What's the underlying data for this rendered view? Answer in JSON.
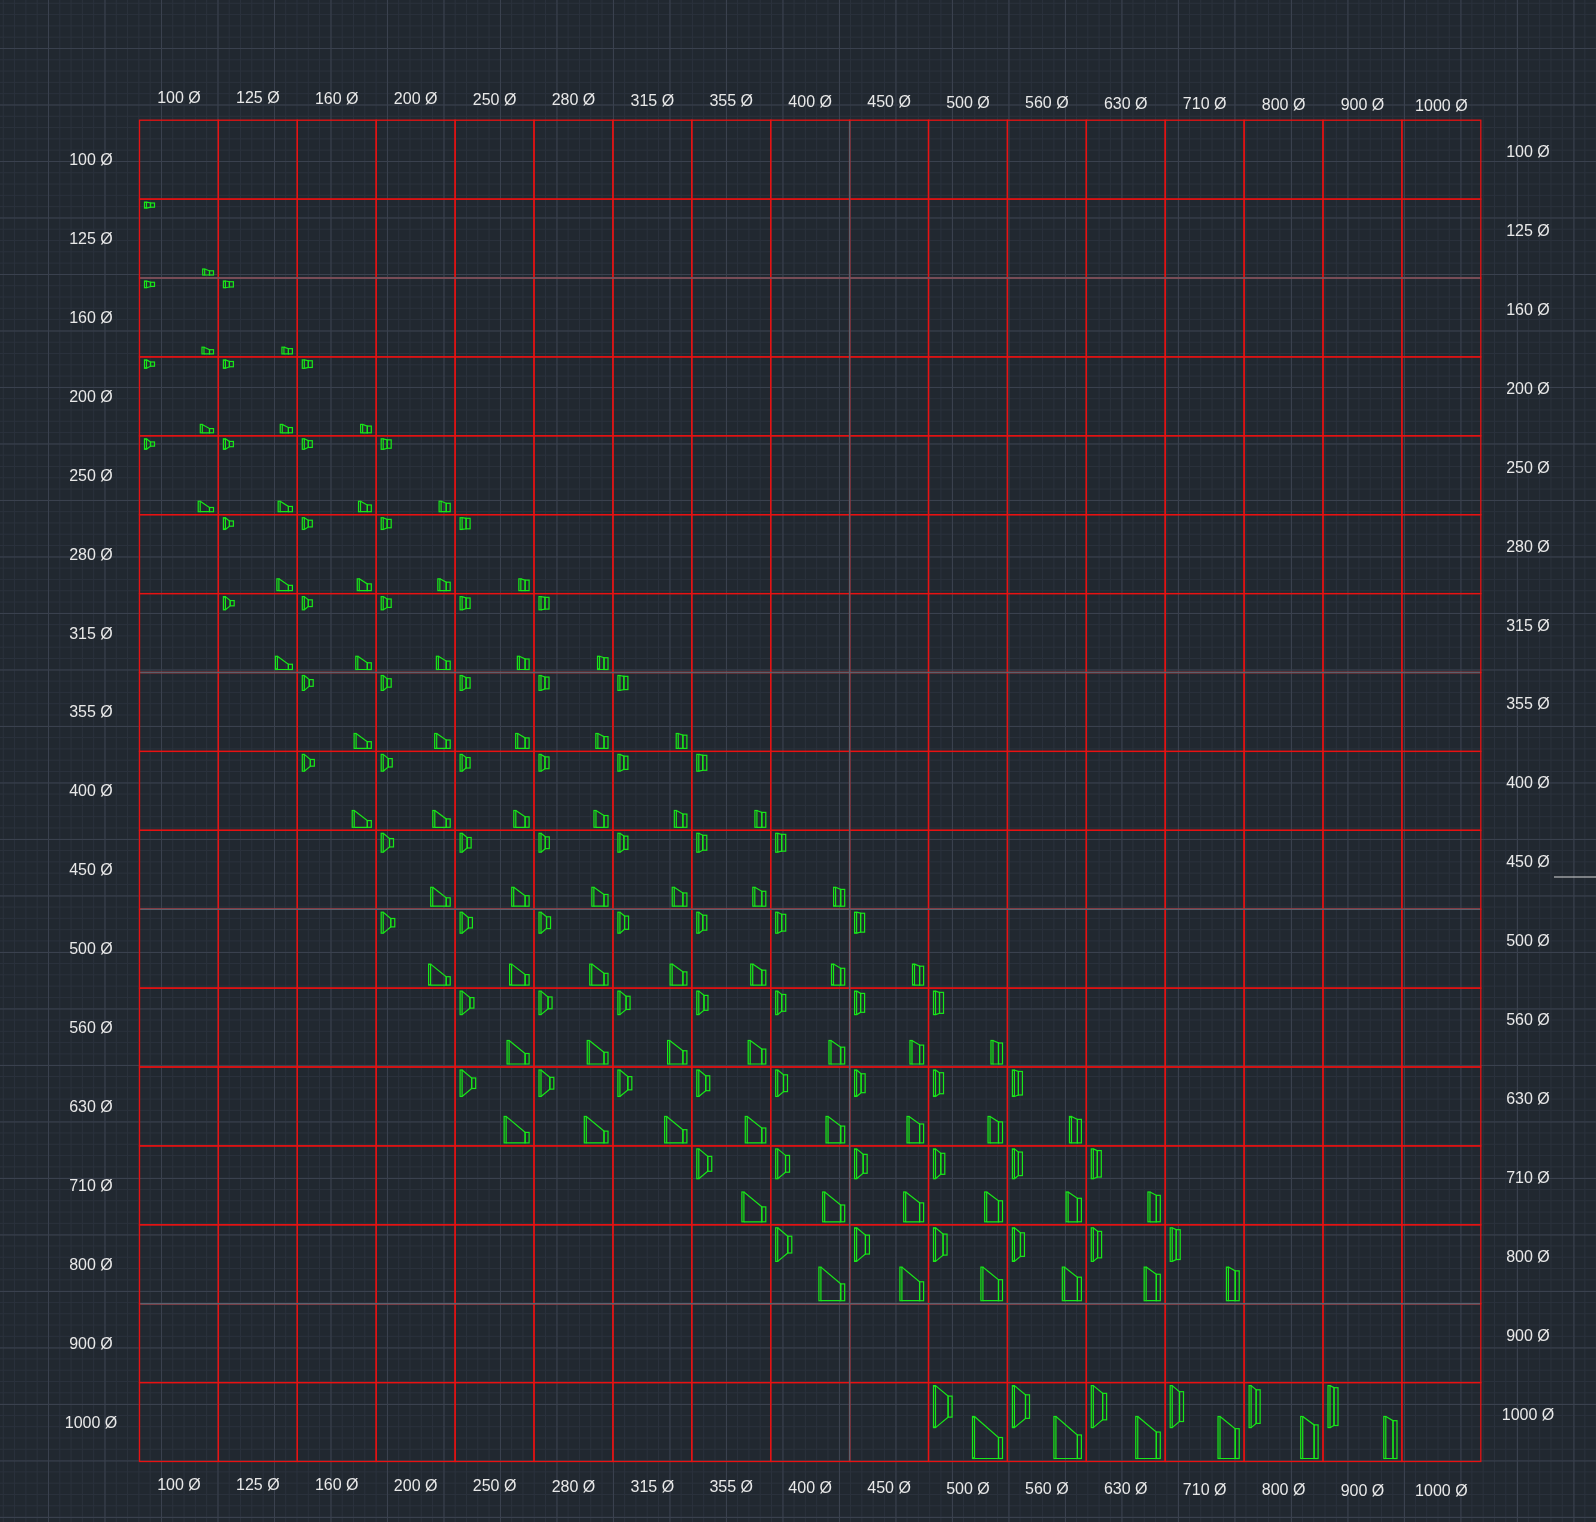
{
  "columns": [
    {
      "label_top": "100 Ø",
      "label_bottom": "100 Ø"
    },
    {
      "label_top": "125 Ø",
      "label_bottom": "125 Ø"
    },
    {
      "label_top": "160 Ø",
      "label_bottom": "160 Ø"
    },
    {
      "label_top": "200 Ø",
      "label_bottom": "200 Ø"
    },
    {
      "label_top": "250 Ø",
      "label_bottom": "250 Ø"
    },
    {
      "label_top": "280 Ø",
      "label_bottom": "280 Ø"
    },
    {
      "label_top": "315 Ø",
      "label_bottom": "315 Ø"
    },
    {
      "label_top": "355 Ø",
      "label_bottom": "355 Ø"
    },
    {
      "label_top": "400 Ø",
      "label_bottom": "400 Ø"
    },
    {
      "label_top": "450 Ø",
      "label_bottom": "450 Ø"
    },
    {
      "label_top": "500 Ø",
      "label_bottom": "500 Ø"
    },
    {
      "label_top": "560 Ø",
      "label_bottom": "560 Ø"
    },
    {
      "label_top": "630 Ø",
      "label_bottom": "630 Ø"
    },
    {
      "label_top": "710 Ø",
      "label_bottom": "710 Ø"
    },
    {
      "label_top": "800 Ø",
      "label_bottom": "800 Ø"
    },
    {
      "label_top": "900 Ø",
      "label_bottom": "900 Ø"
    },
    {
      "label_top": "1000 Ø",
      "label_bottom": "1000 Ø"
    }
  ],
  "rows": [
    {
      "label_left": "100 Ø",
      "label_right": "100 Ø",
      "reducers": [
        false,
        false,
        false,
        false,
        false,
        false,
        false,
        false,
        false,
        false,
        false,
        false,
        false,
        false,
        false,
        false,
        false
      ]
    },
    {
      "label_left": "125 Ø",
      "label_right": "125 Ø",
      "reducers": [
        true,
        false,
        false,
        false,
        false,
        false,
        false,
        false,
        false,
        false,
        false,
        false,
        false,
        false,
        false,
        false,
        false
      ]
    },
    {
      "label_left": "160 Ø",
      "label_right": "160 Ø",
      "reducers": [
        true,
        true,
        false,
        false,
        false,
        false,
        false,
        false,
        false,
        false,
        false,
        false,
        false,
        false,
        false,
        false,
        false
      ]
    },
    {
      "label_left": "200 Ø",
      "label_right": "200 Ø",
      "reducers": [
        true,
        true,
        true,
        false,
        false,
        false,
        false,
        false,
        false,
        false,
        false,
        false,
        false,
        false,
        false,
        false,
        false
      ]
    },
    {
      "label_left": "250 Ø",
      "label_right": "250 Ø",
      "reducers": [
        true,
        true,
        true,
        true,
        false,
        false,
        false,
        false,
        false,
        false,
        false,
        false,
        false,
        false,
        false,
        false,
        false
      ]
    },
    {
      "label_left": "280 Ø",
      "label_right": "280 Ø",
      "reducers": [
        false,
        true,
        true,
        true,
        true,
        false,
        false,
        false,
        false,
        false,
        false,
        false,
        false,
        false,
        false,
        false,
        false
      ]
    },
    {
      "label_left": "315 Ø",
      "label_right": "315 Ø",
      "reducers": [
        false,
        true,
        true,
        true,
        true,
        true,
        false,
        false,
        false,
        false,
        false,
        false,
        false,
        false,
        false,
        false,
        false
      ]
    },
    {
      "label_left": "355 Ø",
      "label_right": "355 Ø",
      "reducers": [
        false,
        false,
        true,
        true,
        true,
        true,
        true,
        false,
        false,
        false,
        false,
        false,
        false,
        false,
        false,
        false,
        false
      ]
    },
    {
      "label_left": "400 Ø",
      "label_right": "400 Ø",
      "reducers": [
        false,
        false,
        true,
        true,
        true,
        true,
        true,
        true,
        false,
        false,
        false,
        false,
        false,
        false,
        false,
        false,
        false
      ]
    },
    {
      "label_left": "450 Ø",
      "label_right": "450 Ø",
      "reducers": [
        false,
        false,
        false,
        true,
        true,
        true,
        true,
        true,
        true,
        false,
        false,
        false,
        false,
        false,
        false,
        false,
        false
      ]
    },
    {
      "label_left": "500 Ø",
      "label_right": "500 Ø",
      "reducers": [
        false,
        false,
        false,
        true,
        true,
        true,
        true,
        true,
        true,
        true,
        false,
        false,
        false,
        false,
        false,
        false,
        false
      ]
    },
    {
      "label_left": "560 Ø",
      "label_right": "560 Ø",
      "reducers": [
        false,
        false,
        false,
        false,
        true,
        true,
        true,
        true,
        true,
        true,
        true,
        false,
        false,
        false,
        false,
        false,
        false
      ]
    },
    {
      "label_left": "630 Ø",
      "label_right": "630 Ø",
      "reducers": [
        false,
        false,
        false,
        false,
        true,
        true,
        true,
        true,
        true,
        true,
        true,
        true,
        false,
        false,
        false,
        false,
        false
      ]
    },
    {
      "label_left": "710 Ø",
      "label_right": "710 Ø",
      "reducers": [
        false,
        false,
        false,
        false,
        false,
        false,
        false,
        true,
        true,
        true,
        true,
        true,
        true,
        false,
        false,
        false,
        false
      ]
    },
    {
      "label_left": "800 Ø",
      "label_right": "800 Ø",
      "reducers": [
        false,
        false,
        false,
        false,
        false,
        false,
        false,
        false,
        true,
        true,
        true,
        true,
        true,
        true,
        false,
        false,
        false
      ]
    },
    {
      "label_left": "900 Ø",
      "label_right": "900 Ø",
      "reducers": [
        false,
        false,
        false,
        false,
        false,
        false,
        false,
        false,
        false,
        false,
        false,
        false,
        false,
        false,
        false,
        false,
        false
      ]
    },
    {
      "label_left": "1000 Ø",
      "label_right": "1000 Ø",
      "reducers": [
        false,
        false,
        false,
        false,
        false,
        false,
        false,
        false,
        false,
        false,
        true,
        true,
        true,
        true,
        true,
        true,
        false
      ]
    }
  ]
}
